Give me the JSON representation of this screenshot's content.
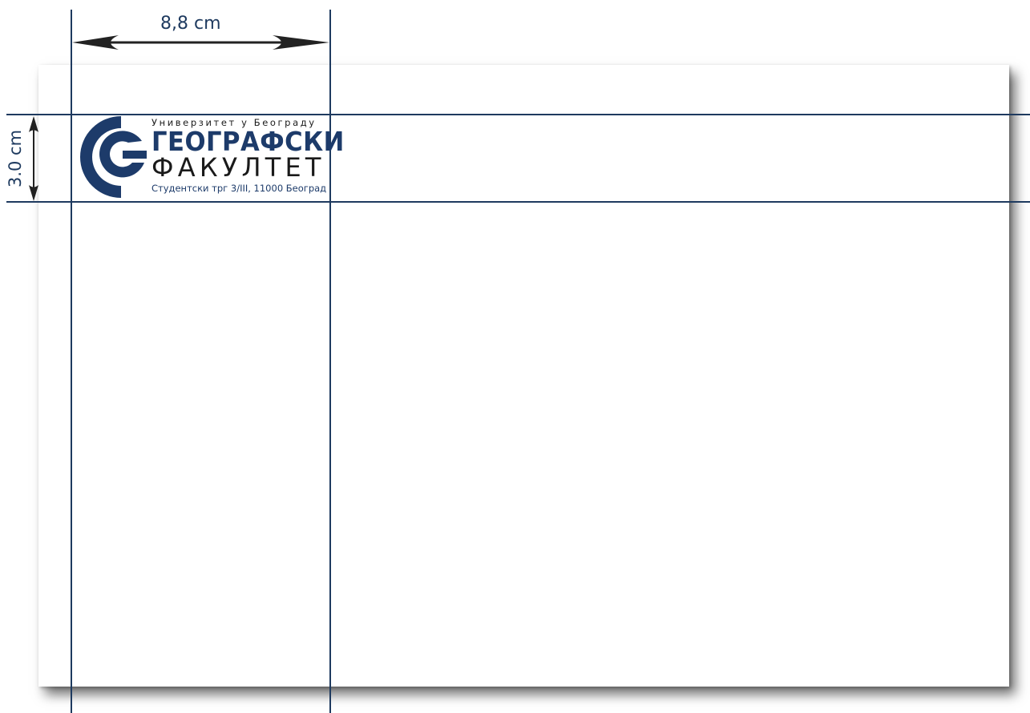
{
  "dimensions": {
    "width_label": "8,8 cm",
    "height_label": "3.0 cm"
  },
  "logo": {
    "university": "Универзитет у Београду",
    "name_line1": "ГЕОГРАФСКИ",
    "name_line2": "ФАКУЛТЕТ",
    "address": "Студентски трг 3/III, 11000 Београд",
    "emblem": "concentric-g-emblem"
  },
  "colors": {
    "guide": "#1e3a5f",
    "brand_blue": "#1d3b6a",
    "text_dark": "#1a1a1a",
    "arrow": "#222222"
  }
}
